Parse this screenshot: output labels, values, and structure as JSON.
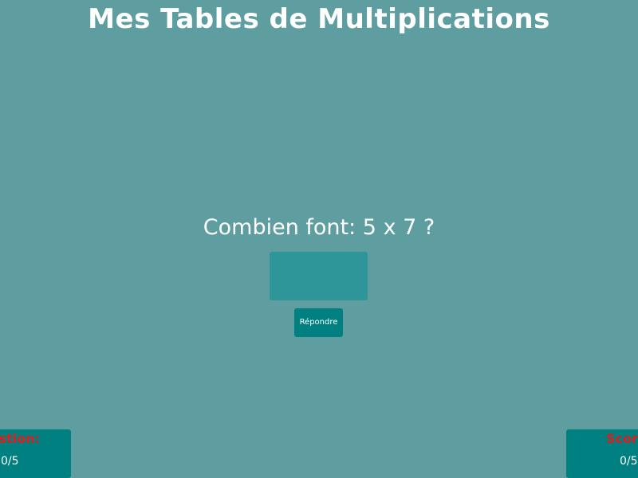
{
  "header": {
    "title": "Mes Tables de Multiplications"
  },
  "quiz": {
    "question": "Combien font: 5 x 7 ?",
    "answer_value": "",
    "submit_label": "Répondre"
  },
  "status": {
    "question_label": "Question:",
    "question_value": "0/5",
    "score_label": "Score:",
    "score_value": "0/5"
  },
  "colors": {
    "background": "#5f9ea0",
    "panel": "#008080",
    "input": "#2e9698",
    "label_red": "#e21b1b",
    "text": "#ffffff"
  }
}
